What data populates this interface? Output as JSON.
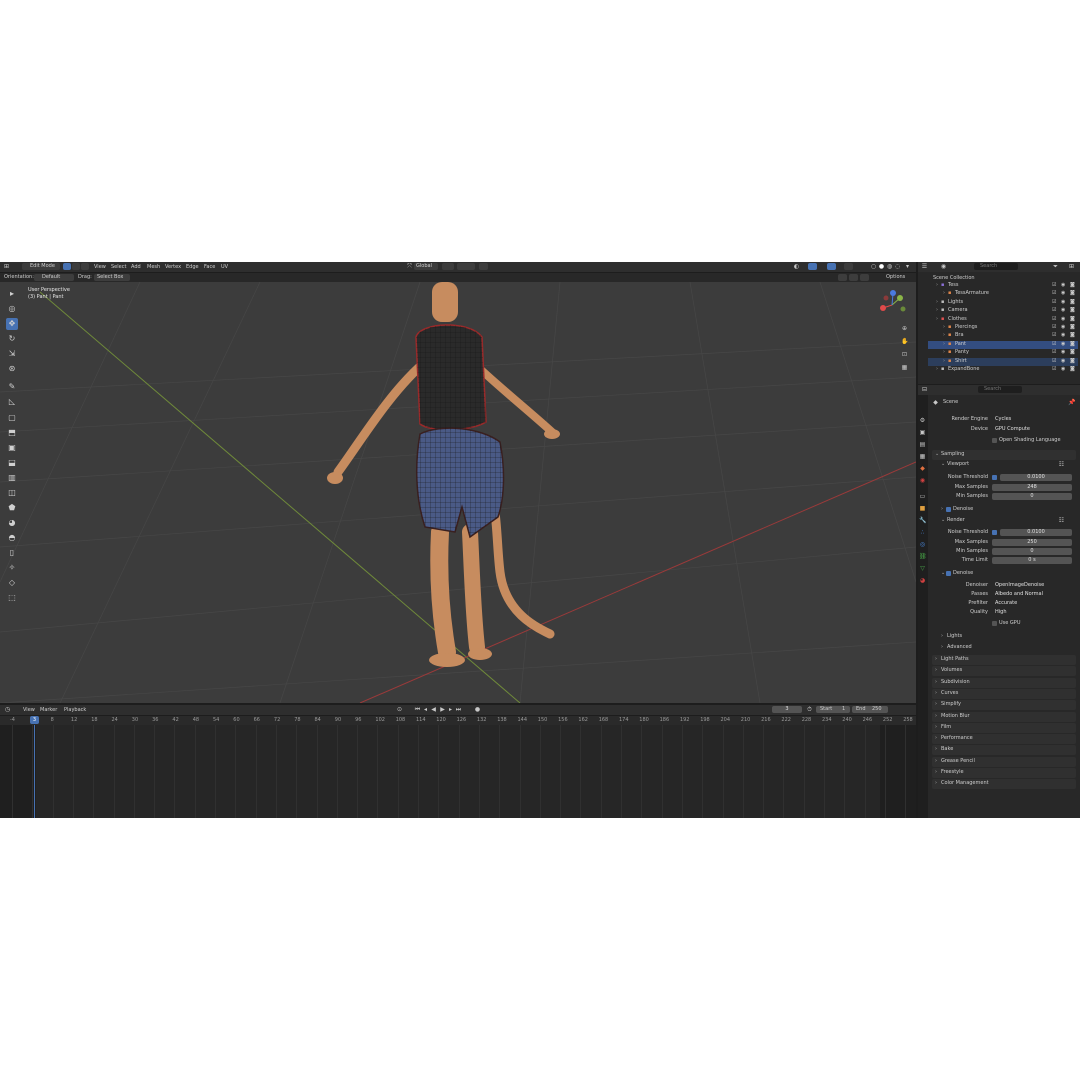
{
  "header": {
    "mode": "Edit Mode",
    "menus": [
      "View",
      "Select",
      "Add",
      "Mesh",
      "Vertex",
      "Edge",
      "Face",
      "UV"
    ],
    "transform_orientation": "Global",
    "orientation_label": "Orientation:",
    "orientation_value": "Default",
    "drag_label": "Drag:",
    "drag_value": "Select Box",
    "options": "Options"
  },
  "viewport": {
    "view_name": "User Perspective",
    "object_name": "(3) Pant | Pant",
    "gizmo": {
      "x": "X",
      "y": "Y",
      "z": "Z"
    }
  },
  "timeline": {
    "menus": [
      "View",
      "Marker",
      "Playback"
    ],
    "current_frame": "3",
    "start_label": "Start",
    "start_value": "1",
    "end_label": "End",
    "end_value": "250",
    "ticks": [
      "-4",
      "4",
      "8",
      "12",
      "18",
      "24",
      "30",
      "36",
      "42",
      "48",
      "54",
      "60",
      "66",
      "72",
      "78",
      "84",
      "90",
      "96",
      "102",
      "108",
      "114",
      "120",
      "126",
      "132",
      "138",
      "144",
      "150",
      "156",
      "162",
      "168",
      "174",
      "180",
      "186",
      "192",
      "198",
      "204",
      "210",
      "216",
      "222",
      "228",
      "234",
      "240",
      "246",
      "252",
      "258"
    ],
    "frame_marker": "3"
  },
  "outliner": {
    "search_placeholder": "Search",
    "title": "Scene Collection",
    "items": [
      {
        "label": "Tess",
        "indent": 1,
        "color": "#8a6fd6"
      },
      {
        "label": "TessArmature",
        "indent": 2,
        "color": "#e0864a"
      },
      {
        "label": "Lights",
        "indent": 1,
        "color": "#bbbbbb"
      },
      {
        "label": "Camera",
        "indent": 1,
        "color": "#bbbbbb"
      },
      {
        "label": "Clothes",
        "indent": 1,
        "color": "#e05050"
      },
      {
        "label": "Piercings",
        "indent": 2,
        "color": "#e0864a"
      },
      {
        "label": "Bra",
        "indent": 2,
        "color": "#e0864a"
      },
      {
        "label": "Pant",
        "indent": 2,
        "color": "#e0864a",
        "selected": true
      },
      {
        "label": "Panty",
        "indent": 2,
        "color": "#e0864a"
      },
      {
        "label": "Shirt",
        "indent": 2,
        "color": "#e0864a",
        "highlight": true
      },
      {
        "label": "ExpandBone",
        "indent": 1,
        "color": "#bbbbbb"
      }
    ]
  },
  "properties": {
    "search_placeholder": "Search",
    "context": "Scene",
    "render_engine_label": "Render Engine",
    "render_engine": "Cycles",
    "device_label": "Device",
    "device": "GPU Compute",
    "osl_label": "Open Shading Language",
    "sampling": "Sampling",
    "viewport": "Viewport",
    "vp_noise_label": "Noise Threshold",
    "vp_noise": "0.0100",
    "vp_max_label": "Max Samples",
    "vp_max": "248",
    "vp_min_label": "Min Samples",
    "vp_min": "0",
    "denoise": "Denoise",
    "render": "Render",
    "r_noise_label": "Noise Threshold",
    "r_noise": "0.0100",
    "r_max_label": "Max Samples",
    "r_max": "250",
    "r_min_label": "Min Samples",
    "r_min": "0",
    "r_time_label": "Time Limit",
    "r_time": "0 s",
    "denoise2": "Denoise",
    "denoiser_label": "Denoiser",
    "denoiser": "OpenImageDenoise",
    "passes_label": "Passes",
    "passes": "Albedo and Normal",
    "prefilter_label": "Prefilter",
    "prefilter": "Accurate",
    "quality_label": "Quality",
    "quality": "High",
    "use_gpu": "Use GPU",
    "lights": "Lights",
    "advanced": "Advanced",
    "panels": [
      "Light Paths",
      "Volumes",
      "Subdivision",
      "Curves",
      "Simplify",
      "Motion Blur",
      "Film",
      "Performance",
      "Bake",
      "Grease Pencil",
      "Freestyle",
      "Color Management"
    ]
  }
}
